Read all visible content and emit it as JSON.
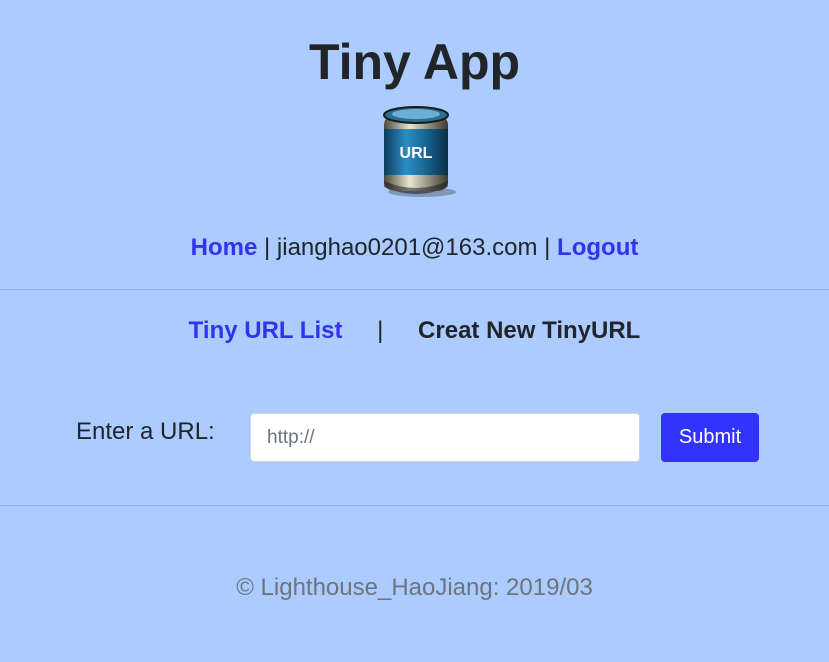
{
  "header": {
    "title": "Tiny App",
    "logo_icon": "tinyurl-logo-icon",
    "logo_text": "URL"
  },
  "nav": {
    "home_label": "Home",
    "separator": "|",
    "user_email": "jianghao0201@163.com",
    "logout_label": "Logout"
  },
  "tabs": {
    "list_label": "Tiny URL List",
    "separator": "|",
    "create_label": "Creat New TinyURL"
  },
  "form": {
    "label": "Enter a URL:",
    "input_placeholder": "http://",
    "input_value": "",
    "submit_label": "Submit"
  },
  "footer": {
    "text": "© Lighthouse_HaoJiang: 2019/03"
  },
  "colors": {
    "background": "#accbff",
    "link": "#3333ee",
    "button": "#3333ff",
    "text": "#212529",
    "muted": "#6c757d"
  }
}
